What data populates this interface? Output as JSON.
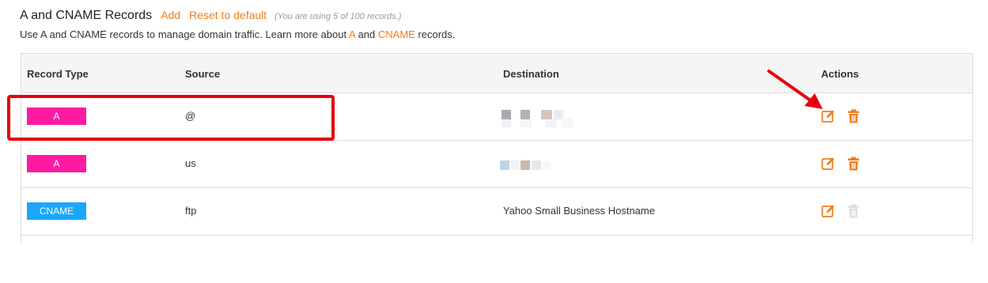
{
  "header": {
    "title": "A and CNAME Records",
    "add_label": "Add",
    "reset_label": "Reset to default",
    "usage_note": "(You are using 5 of 100 records.)"
  },
  "description": {
    "prefix": "Use A and CNAME records to manage domain traffic. Learn more about ",
    "link_a": "A",
    "middle": " and ",
    "link_cname": "CNAME",
    "suffix": " records."
  },
  "table": {
    "columns": [
      "Record Type",
      "Source",
      "Destination",
      "Actions"
    ],
    "rows": [
      {
        "type": "A",
        "source": "@",
        "destination": "",
        "delete_enabled": true
      },
      {
        "type": "A",
        "source": "us",
        "destination": "",
        "delete_enabled": true
      },
      {
        "type": "CNAME",
        "source": "ftp",
        "destination": "Yahoo Small Business Hostname",
        "delete_enabled": false
      }
    ]
  },
  "icons": {
    "edit": "edit-icon",
    "delete": "trash-icon"
  },
  "colors": {
    "accent": "#f07d1a",
    "a_badge": "#ff1aa3",
    "cname_badge": "#1aa7ff",
    "highlight": "#e8000d"
  }
}
